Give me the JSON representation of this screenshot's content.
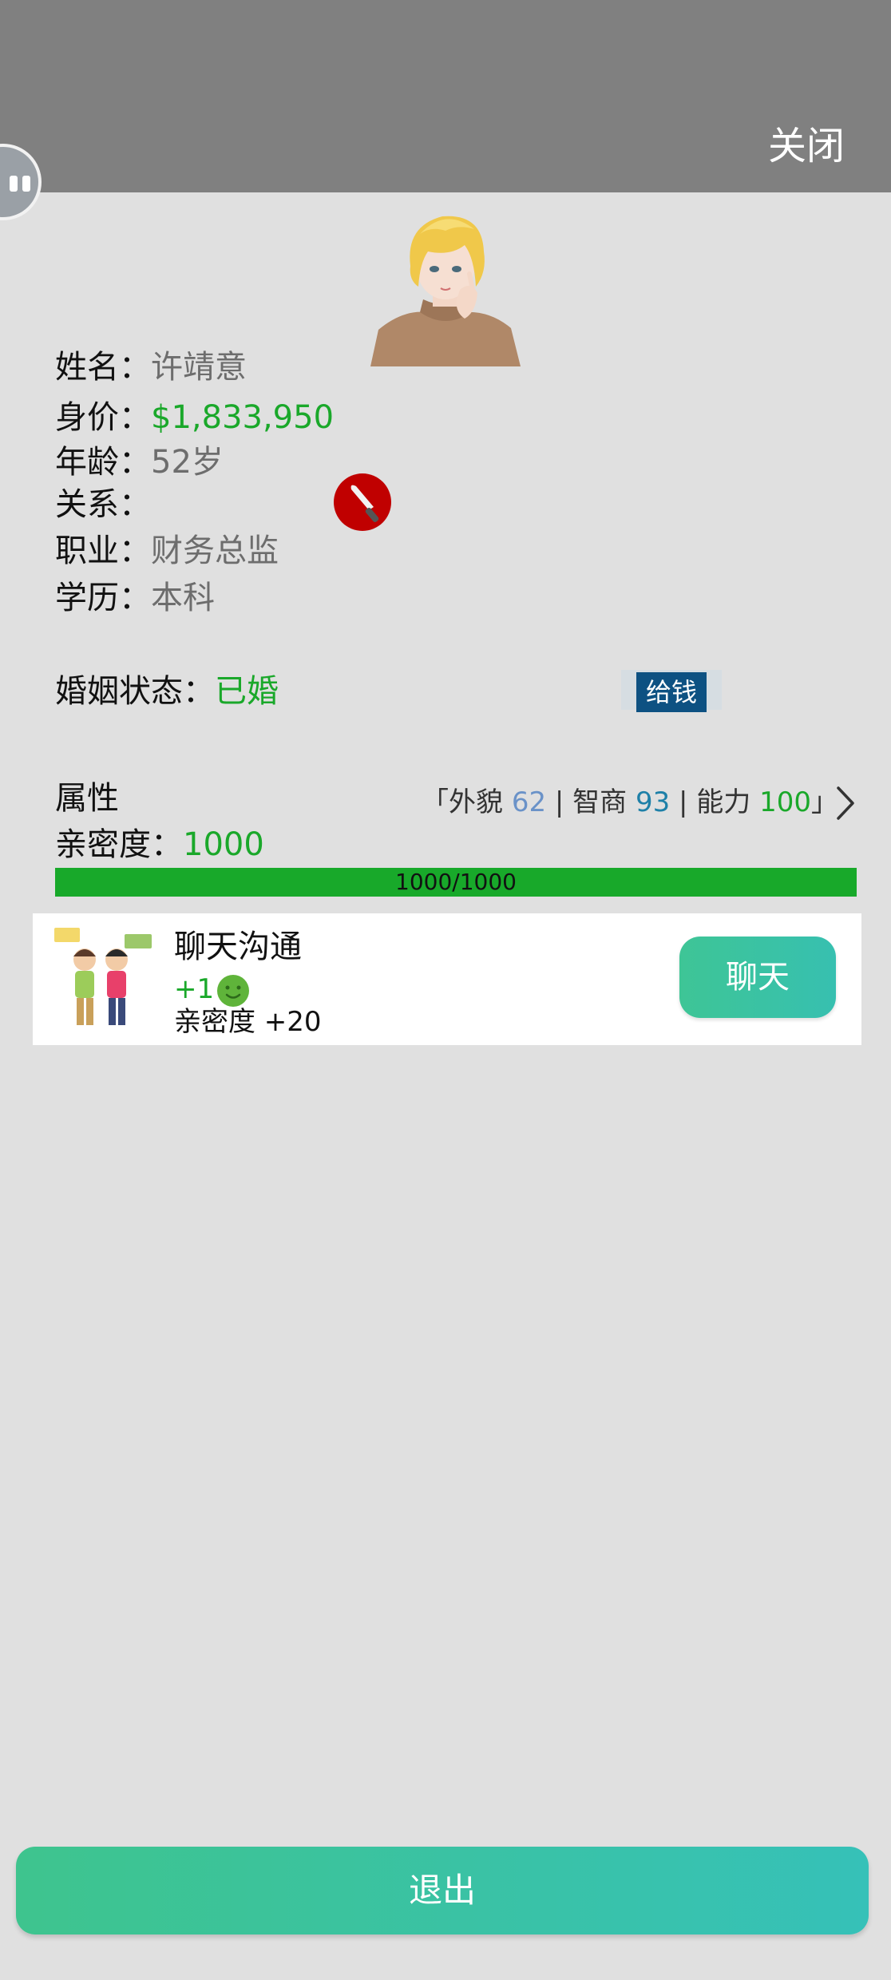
{
  "header": {
    "close_label": "关闭"
  },
  "profile": {
    "name_label": "姓名：",
    "name_value": "许靖意",
    "worth_label": "身价：",
    "worth_value": "$1,833,950",
    "age_label": "年龄：",
    "age_value": "52岁",
    "relation_label": "关系：",
    "relation_value": "",
    "job_label": "职业：",
    "job_value": "财务总监",
    "edu_label": "学历：",
    "edu_value": "本科",
    "relation_icon": "knife-icon"
  },
  "marriage": {
    "label": "婚姻状态：",
    "value": "已婚",
    "give_money_label": "给钱"
  },
  "attributes": {
    "label": "属性",
    "open_bracket": "「外貌 ",
    "looks_value": "62",
    "sep1": " |  智商 ",
    "iq_value": "93",
    "sep2": " | 能力 ",
    "ability_value": "100",
    "close_bracket": "」"
  },
  "intimacy": {
    "label": "亲密度：",
    "value": "1000",
    "progress_text": "1000/1000",
    "progress_fraction": 1.0
  },
  "action_card": {
    "title": "聊天沟通",
    "gain": "+1",
    "gain_icon": "smiley-icon",
    "desc": "亲密度 +20",
    "button_label": "聊天"
  },
  "footer": {
    "exit_label": "退出"
  },
  "colors": {
    "topbar": "#808080",
    "background": "#e0e0e0",
    "green_text": "#1aa82a",
    "progress_fill": "#18a92a",
    "give_button": "#0d5182",
    "teal_button": "#3ec596"
  }
}
